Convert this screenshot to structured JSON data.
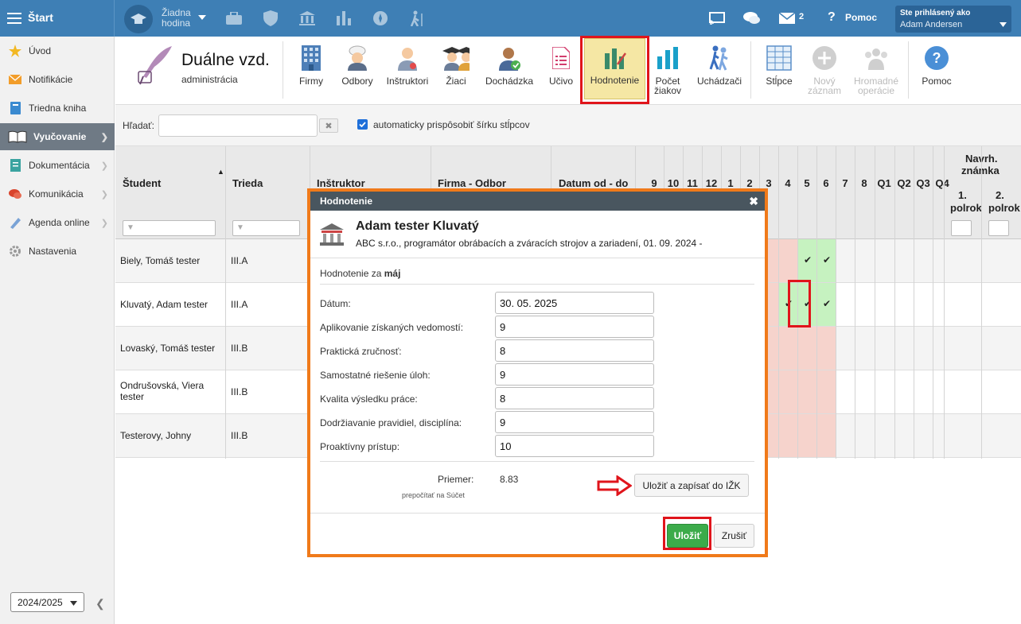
{
  "topbar": {
    "start_label": "Štart",
    "lesson_line1": "Žiadna",
    "lesson_line2": "hodina",
    "mail_count": "2",
    "help_label": "Pomoc",
    "user_caption": "Ste prihlásený ako",
    "user_name": "Adam Andersen"
  },
  "sidebar": {
    "items": [
      {
        "label": "Úvod",
        "icon": "star-icon"
      },
      {
        "label": "Notifikácie",
        "icon": "envelope-icon"
      },
      {
        "label": "Triedna kniha",
        "icon": "book-icon"
      },
      {
        "label": "Vyučovanie",
        "icon": "open-book-icon"
      },
      {
        "label": "Dokumentácia",
        "icon": "document-icon"
      },
      {
        "label": "Komunikácia",
        "icon": "chat-icon"
      },
      {
        "label": "Agenda online",
        "icon": "pen-icon"
      },
      {
        "label": "Nastavenia",
        "icon": "gear-icon"
      }
    ],
    "school_year": "2024/2025"
  },
  "module": {
    "title": "Duálne vzd.",
    "subtitle": "administrácia"
  },
  "toolbar": {
    "firmy": "Firmy",
    "odbory": "Odbory",
    "instruktori": "Inštruktori",
    "ziaci": "Žiaci",
    "dochadzka": "Dochádzka",
    "ucivo": "Učivo",
    "hodnotenie": "Hodnotenie",
    "pocet_1": "Počet",
    "pocet_2": "žiakov",
    "uchadzaci": "Uchádzači",
    "stlpce": "Stĺpce",
    "novy_1": "Nový",
    "novy_2": "záznam",
    "hromadne_1": "Hromadné",
    "hromadne_2": "operácie",
    "pomoc": "Pomoc"
  },
  "search": {
    "label": "Hľadať:",
    "value": "",
    "autofit_label": "automaticky prispôsobiť šírku stĺpcov",
    "autofit_checked": true
  },
  "grid": {
    "headers": {
      "student": "Študent",
      "trieda": "Trieda",
      "instruktor": "Inštruktor",
      "firma": "Firma - Odbor",
      "datum": "Datum od - do",
      "months": [
        "9",
        "10",
        "11",
        "12",
        "1",
        "2",
        "3",
        "4",
        "5",
        "6",
        "7",
        "8",
        "Q1",
        "Q2",
        "Q3",
        "Q4"
      ],
      "navrh_1": "Navrh.",
      "navrh_2": "známka",
      "polrok1_a": "1.",
      "polrok1_b": "polrok",
      "polrok2_a": "2.",
      "polrok2_b": "polrok"
    },
    "rows": [
      {
        "student": "Biely, Tomáš tester",
        "trieda": "III.A"
      },
      {
        "student": "Kluvatý, Adam tester",
        "trieda": "III.A"
      },
      {
        "student": "Lovaský, Tomáš tester",
        "trieda": "III.B"
      },
      {
        "student": "Ondrušovská, Viera tester",
        "trieda": "III.B"
      },
      {
        "student": "Testerovy, Johny",
        "trieda": "III.B"
      }
    ],
    "check_mark": "✔",
    "colors": {
      "done": "#c6f2c0",
      "missing": "#f6d3cc"
    }
  },
  "dialog": {
    "title": "Hodnotenie",
    "student_name": "Adam tester Kluvatý",
    "student_info": "ABC s.r.o., programátor obrábacích a zváracích strojov a zariadení, 01. 09. 2024 -",
    "period_prefix": "Hodnotenie za",
    "period_month": "máj",
    "fields": [
      {
        "label": "Dátum:",
        "value": "30. 05. 2025"
      },
      {
        "label": "Aplikovanie získaných vedomostí:",
        "value": "9"
      },
      {
        "label": "Praktická zručnosť:",
        "value": "8"
      },
      {
        "label": "Samostatné riešenie úloh:",
        "value": "9"
      },
      {
        "label": "Kvalita výsledku práce:",
        "value": "8"
      },
      {
        "label": "Dodržiavanie pravidiel, disciplína:",
        "value": "9"
      },
      {
        "label": "Proaktívny prístup:",
        "value": "10"
      }
    ],
    "average_label": "Priemer:",
    "average_value": "8.83",
    "recalc_label": "prepočítať na Súčet",
    "save_ijk_label": "Uložiť a zapísať do IŽK",
    "save_label": "Uložiť",
    "cancel_label": "Zrušiť"
  }
}
